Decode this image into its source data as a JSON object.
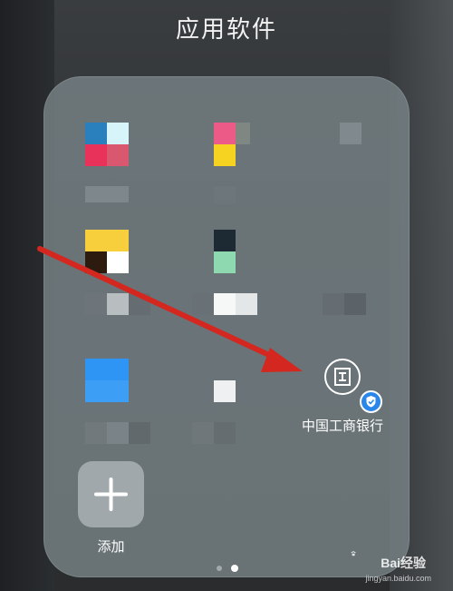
{
  "folder": {
    "title": "应用软件"
  },
  "apps": {
    "icbc_label": "中国工商银行",
    "add_label": "添加"
  },
  "watermark": {
    "brand": "Bai经验",
    "url": "jingyan.baidu.com"
  },
  "icons": {
    "icbc": "icbc-logo-icon",
    "badge": "verified-shield-icon",
    "add": "plus-icon",
    "paw": "baidu-paw-icon"
  },
  "colors": {
    "badge": "#2a86e8",
    "arrow": "#d4271f",
    "folder_bg": "#788286"
  },
  "pagination": {
    "pages": 2,
    "current": 2
  }
}
